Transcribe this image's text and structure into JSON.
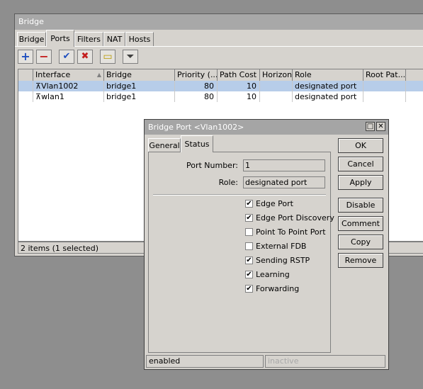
{
  "bridge_window": {
    "title": "Bridge",
    "tabs": [
      "Bridge",
      "Ports",
      "Filters",
      "NAT",
      "Hosts"
    ],
    "active_tab": "Ports",
    "toolbar": [
      {
        "name": "add",
        "glyph": "+",
        "color": "#1f4fbf"
      },
      {
        "name": "remove",
        "glyph": "−",
        "color": "#c41f1f"
      },
      {
        "name": "enable",
        "glyph": "✔",
        "color": "#1f4fbf"
      },
      {
        "name": "disable",
        "glyph": "✖",
        "color": "#c41f1f"
      },
      {
        "name": "comment",
        "glyph": "▭",
        "color": "#b89a00"
      },
      {
        "name": "filter",
        "glyph": "⏷",
        "color": "#404040"
      }
    ],
    "columns": [
      "Interface",
      "Bridge",
      "Priority (...",
      "Path Cost",
      "Horizon",
      "Role",
      "Root Pat..."
    ],
    "rows": [
      {
        "interface": "Vlan1002",
        "bridge": "bridge1",
        "priority": "80",
        "path_cost": "10",
        "horizon": "",
        "role": "designated port",
        "root_path": "",
        "selected": true
      },
      {
        "interface": "wlan1",
        "bridge": "bridge1",
        "priority": "80",
        "path_cost": "10",
        "horizon": "",
        "role": "designated port",
        "root_path": "",
        "selected": false
      }
    ],
    "status": "2 items (1 selected)"
  },
  "dialog": {
    "title": "Bridge Port <Vlan1002>",
    "tabs": [
      "General",
      "Status"
    ],
    "active_tab": "Status",
    "port_number_label": "Port Number:",
    "port_number": "1",
    "role_label": "Role:",
    "role": "designated port",
    "checkboxes": [
      {
        "label": "Edge Port",
        "checked": true
      },
      {
        "label": "Edge Port Discovery",
        "checked": true
      },
      {
        "label": "Point To Point Port",
        "checked": false
      },
      {
        "label": "External FDB",
        "checked": false
      },
      {
        "label": "Sending RSTP",
        "checked": true
      },
      {
        "label": "Learning",
        "checked": true
      },
      {
        "label": "Forwarding",
        "checked": true
      }
    ],
    "buttons": [
      "OK",
      "Cancel",
      "Apply",
      "Disable",
      "Comment",
      "Copy",
      "Remove"
    ],
    "status_left": "enabled",
    "status_right": "inactive"
  }
}
